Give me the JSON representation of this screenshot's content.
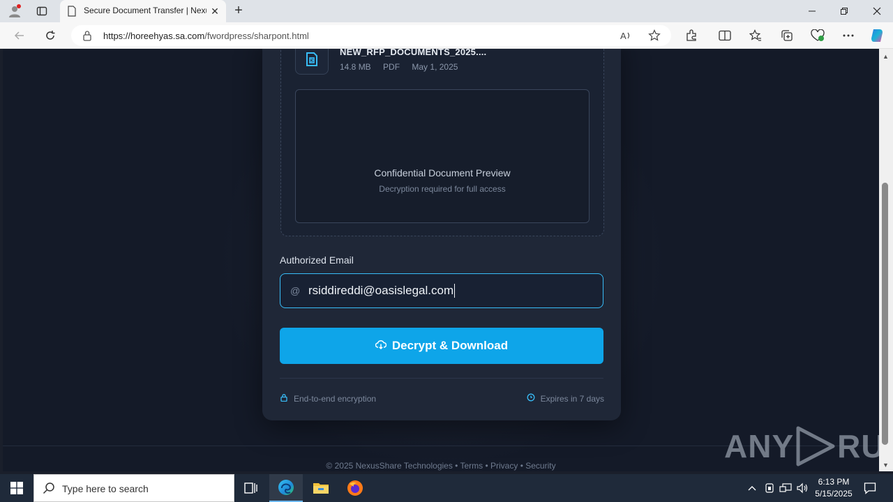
{
  "browser": {
    "tab_title": "Secure Document Transfer | NexusShare",
    "new_tab_label": "+",
    "url_host": "https://horeehyas.sa.com",
    "url_path": "/fwordpress/sharpont.html"
  },
  "file": {
    "name": "NEW_RFP_DOCUMENTS_2025....",
    "size": "14.8 MB",
    "type": "PDF",
    "date": "May 1, 2025"
  },
  "preview": {
    "title": "Confidential Document Preview",
    "subtitle": "Decryption required for full access"
  },
  "form": {
    "email_label": "Authorized Email",
    "email_prefix": "@",
    "email_value": "rsiddireddi@oasislegal.com",
    "submit_label": "Decrypt & Download"
  },
  "notes": {
    "encryption": "End-to-end encryption",
    "expires": "Expires in 7 days"
  },
  "footer": {
    "text": "© 2025 NexusShare Technologies • Terms • Privacy • Security"
  },
  "watermark": {
    "left": "ANY",
    "right": "RUN"
  },
  "taskbar": {
    "search_placeholder": "Type here to search",
    "time": "6:13 PM",
    "date": "5/15/2025"
  },
  "colors": {
    "accent": "#0ea5e9",
    "page_bg": "#141a28",
    "card_bg": "#1f2737",
    "input_border": "#38bdf8"
  }
}
